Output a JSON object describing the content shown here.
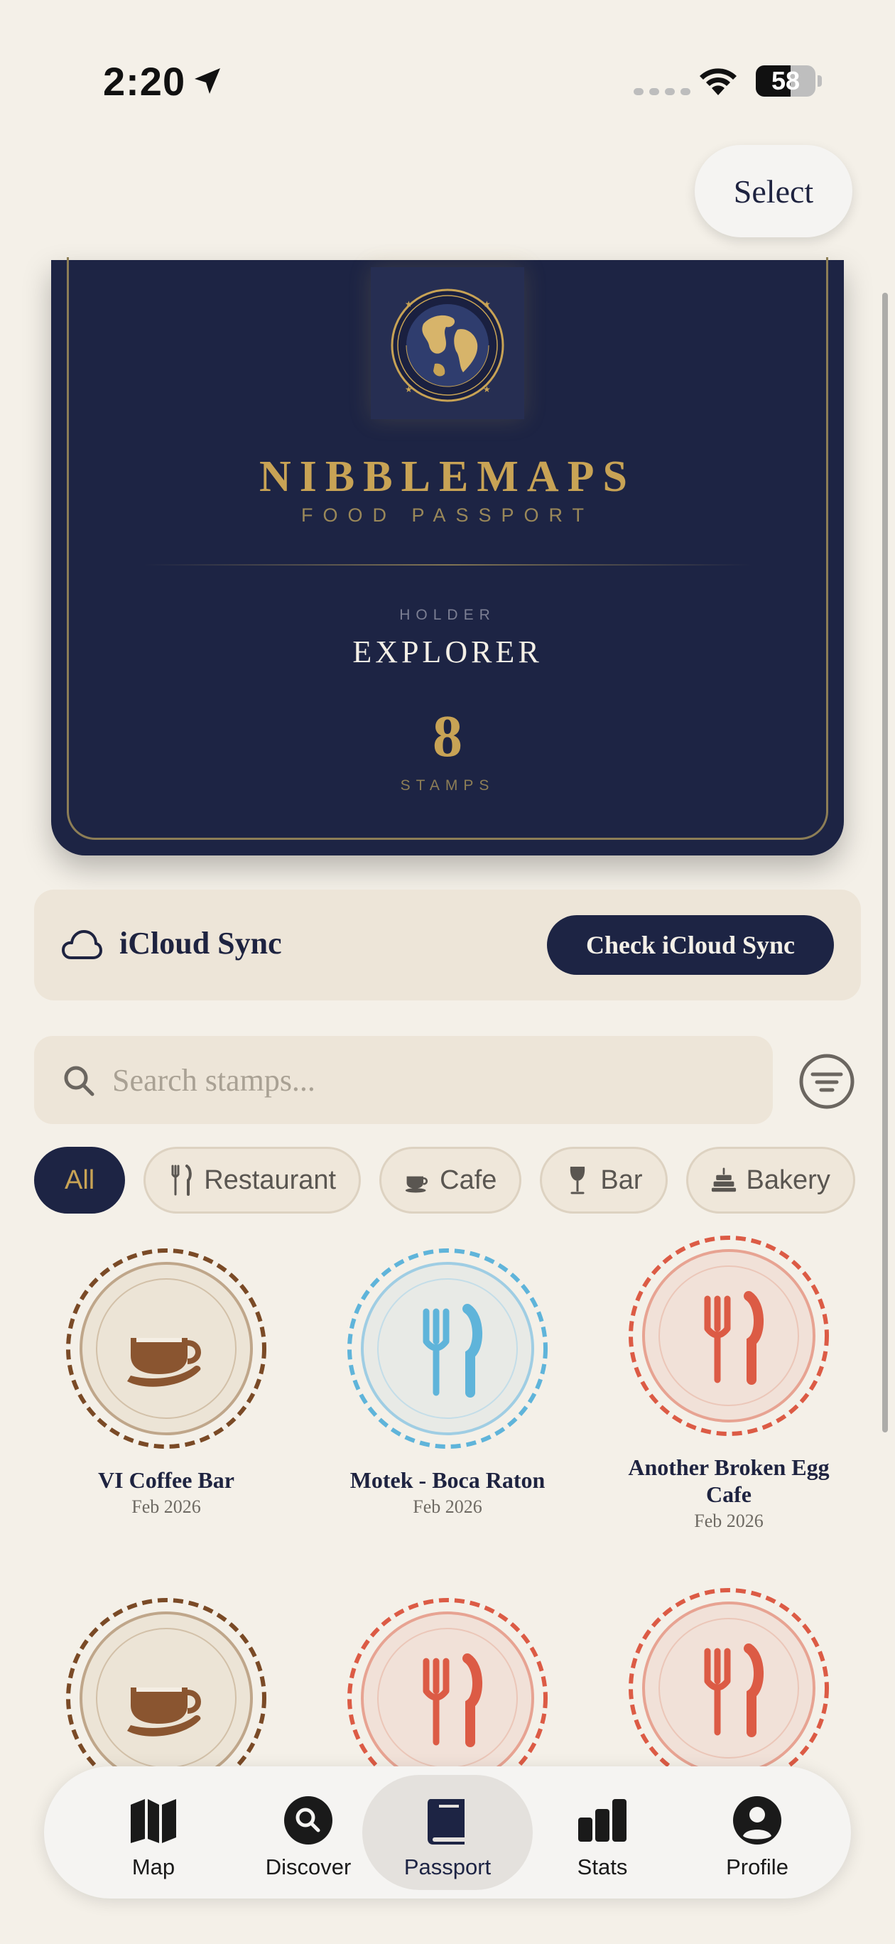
{
  "status_bar": {
    "time": "2:20",
    "battery": "58",
    "battery_level": 0.58
  },
  "header": {
    "select_label": "Select"
  },
  "passport": {
    "title": "NIBBLEMAPS",
    "subtitle": "FOOD PASSPORT",
    "holder_label": "HOLDER",
    "holder_name": "EXPLORER",
    "stamp_count": "8",
    "stamp_label": "STAMPS"
  },
  "icloud": {
    "label": "iCloud Sync",
    "button_label": "Check iCloud Sync"
  },
  "search": {
    "placeholder": "Search stamps...",
    "value": ""
  },
  "filters": [
    {
      "label": "All",
      "icon": "none",
      "active": true
    },
    {
      "label": "Restaurant",
      "icon": "fork-knife-icon",
      "active": false
    },
    {
      "label": "Cafe",
      "icon": "coffee-cup-icon",
      "active": false
    },
    {
      "label": "Bar",
      "icon": "wine-glass-icon",
      "active": false
    },
    {
      "label": "Bakery",
      "icon": "cake-icon",
      "active": false
    }
  ],
  "stamps": [
    {
      "name": "VI Coffee Bar",
      "date": "Feb 2026",
      "type": "cafe"
    },
    {
      "name": "Motek - Boca Raton",
      "date": "Feb 2026",
      "type": "restaurant-blue"
    },
    {
      "name": "Another Broken Egg Cafe",
      "date": "Feb 2026",
      "type": "restaurant-red"
    },
    {
      "name": "",
      "date": "",
      "type": "cafe"
    },
    {
      "name": "",
      "date": "",
      "type": "restaurant-red"
    },
    {
      "name": "",
      "date": "",
      "type": "restaurant-red"
    }
  ],
  "tabs": [
    {
      "label": "Map",
      "icon": "map-icon",
      "active": false
    },
    {
      "label": "Discover",
      "icon": "search-circle-icon",
      "active": false
    },
    {
      "label": "Passport",
      "icon": "book-icon",
      "active": true
    },
    {
      "label": "Stats",
      "icon": "bar-chart-icon",
      "active": false
    },
    {
      "label": "Profile",
      "icon": "person-circle-icon",
      "active": false
    }
  ],
  "colors": {
    "navy": "#1D2444",
    "gold": "#C8A355",
    "cafe_brown": "#7A4A26",
    "restaurant_blue": "#5FB4DA",
    "restaurant_red": "#DC5B45",
    "background": "#F4F0E8"
  }
}
